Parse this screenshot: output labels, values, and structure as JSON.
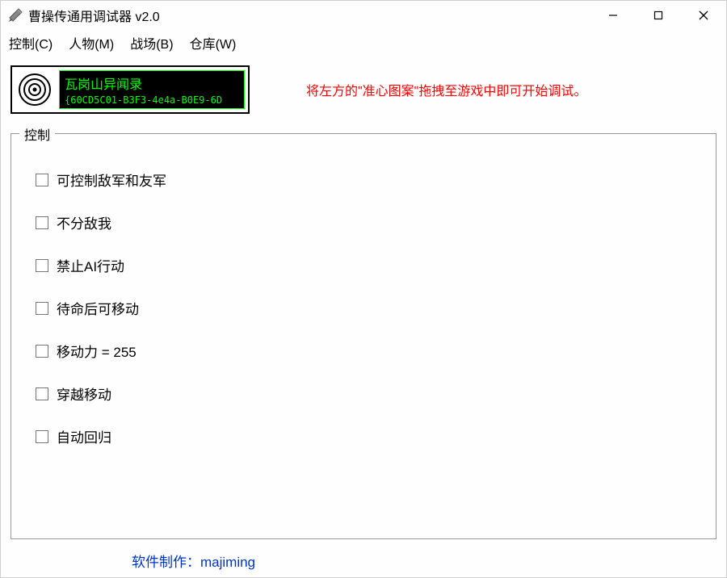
{
  "window": {
    "title": "曹操传通用调试器 v2.0"
  },
  "menubar": {
    "control": "控制(C)",
    "character": "人物(M)",
    "battlefield": "战场(B)",
    "inventory": "仓库(W)"
  },
  "info": {
    "line1": "瓦岗山异闻录",
    "line2": "{60CD5C01-B3F3-4e4a-B0E9-6D"
  },
  "hint": "将左方的\"准心图案\"拖拽至游戏中即可开始调试。",
  "group": {
    "title": "控制",
    "checkboxes": [
      "可控制敌军和友军",
      "不分敌我",
      "禁止AI行动",
      "待命后可移动",
      "移动力 = 255",
      "穿越移动",
      "自动回归"
    ]
  },
  "footer": "软件制作：majiming"
}
